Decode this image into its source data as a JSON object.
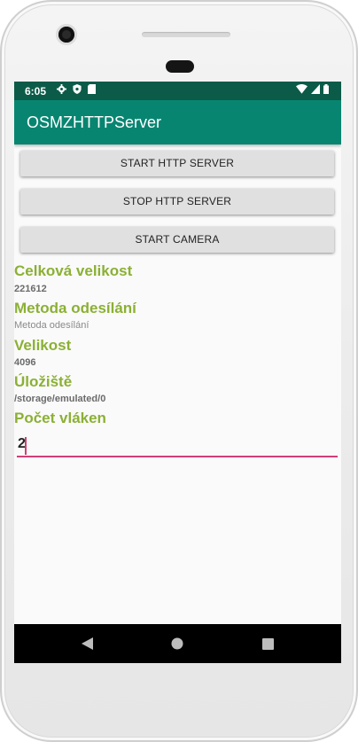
{
  "status_bar": {
    "time": "6:05",
    "left_icons": [
      "gear-icon",
      "shield-icon",
      "sim-card-icon"
    ],
    "right_icons": [
      "wifi-icon",
      "signal-icon",
      "battery-icon"
    ]
  },
  "app_bar": {
    "title": "OSMZHTTPServer",
    "color": "#088571"
  },
  "buttons": {
    "start_server": "START HTTP SERVER",
    "stop_server": "STOP HTTP SERVER",
    "start_camera": "START CAMERA"
  },
  "info": {
    "total_size_label": "Celková velikost",
    "total_size_value": "221612",
    "method_label": "Metoda odesílání",
    "method_value": "Metoda odesílání",
    "size_label": "Velikost",
    "size_value": "4096",
    "storage_label": "Úložiště",
    "storage_value": "/storage/emulated/0",
    "threads_label": "Počet vláken"
  },
  "threads_input": {
    "value": "2"
  },
  "nav_bar": {
    "icons": [
      "back-icon",
      "home-icon",
      "recents-icon"
    ]
  },
  "colors": {
    "status_bar": "#0c5b49",
    "label_green": "#8bb035",
    "input_accent": "#d23e77"
  }
}
